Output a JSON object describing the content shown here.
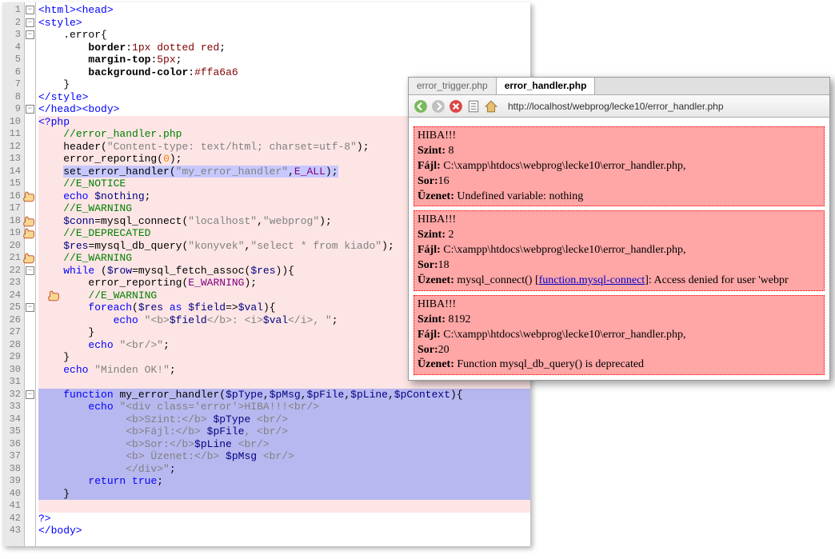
{
  "editor": {
    "lines": [
      {
        "n": 1,
        "fold": true,
        "html": "<span class='tag'>&lt;html&gt;&lt;head&gt;</span>"
      },
      {
        "n": 2,
        "fold": true,
        "html": "<span class='tag'>&lt;style&gt;</span>"
      },
      {
        "n": 3,
        "fold": true,
        "html": "    .error{"
      },
      {
        "n": 4,
        "html": "        <span class='prop'>border</span>:<span class='cssval'>1px dotted red</span>;"
      },
      {
        "n": 5,
        "html": "        <span class='prop'>margin-top</span>:<span class='cssval'>5px</span>;"
      },
      {
        "n": 6,
        "html": "        <span class='prop'>background-color</span>:<span class='cssval'>#ffa6a6</span>"
      },
      {
        "n": 7,
        "html": "    }"
      },
      {
        "n": 8,
        "html": "<span class='tag'>&lt;/style&gt;</span>"
      },
      {
        "n": 9,
        "fold": true,
        "html": "<span class='tag'>&lt;/head&gt;&lt;body&gt;</span>"
      },
      {
        "n": 10,
        "hl": "red",
        "html": "<span class='keyword'>&lt;?php</span>"
      },
      {
        "n": 11,
        "hl": "red",
        "html": "    <span class='comment'>//error_handler.php</span>"
      },
      {
        "n": 12,
        "hl": "red",
        "html": "    <span class='func'>header</span>(<span class='string'>\"Content-type: text/html; charset=utf-8\"</span>);"
      },
      {
        "n": 13,
        "hl": "red",
        "html": "    <span class='func'>error_reporting</span>(<span class='num'>0</span>);"
      },
      {
        "n": 14,
        "hl": "red",
        "html": "    <span class='hl-sel'><span class='func'>set_error_handler</span>(<span class='string'>\"my_error_handler\"</span>,<span class='const'>E_ALL</span>);</span>"
      },
      {
        "n": 15,
        "hl": "red",
        "html": "    <span class='comment'>//E_NOTICE</span>"
      },
      {
        "n": 16,
        "hl": "red",
        "hand": true,
        "html": "    <span class='keyword'>echo</span> <span class='var'>$nothing</span>;"
      },
      {
        "n": 17,
        "hl": "red",
        "html": "    <span class='comment'>//E_WARNING</span>"
      },
      {
        "n": 18,
        "hl": "red",
        "hand": true,
        "html": "    <span class='var'>$conn</span>=<span class='func'>mysql_connect</span>(<span class='string'>\"localhost\"</span>,<span class='string'>\"webprog\"</span>);"
      },
      {
        "n": 19,
        "hl": "red",
        "hand": true,
        "html": "    <span class='comment'>//E_DEPRECATED</span>"
      },
      {
        "n": 20,
        "hl": "red",
        "html": "    <span class='var'>$res</span>=<span class='func'>mysql_db_query</span>(<span class='string'>\"konyvek\"</span>,<span class='string'>\"select * from kiado\"</span>);"
      },
      {
        "n": 21,
        "hl": "red",
        "hand": true,
        "html": "    <span class='comment'>//E_WARNING</span>"
      },
      {
        "n": 22,
        "hl": "red",
        "fold": true,
        "html": "    <span class='keyword'>while</span> (<span class='var'>$row</span>=<span class='func'>mysql_fetch_assoc</span>(<span class='var'>$res</span>)){"
      },
      {
        "n": 23,
        "hl": "red",
        "html": "        <span class='func'>error_reporting</span>(<span class='const'>E_WARNING</span>);"
      },
      {
        "n": 24,
        "hl": "red",
        "hand": true,
        "indent": 1,
        "html": "        <span class='comment'>//E_WARNING</span>"
      },
      {
        "n": 25,
        "hl": "red",
        "fold": true,
        "html": "        <span class='keyword'>foreach</span>(<span class='var'>$res</span> <span class='keyword'>as</span> <span class='var'>$field</span>=&gt;<span class='var'>$val</span>){"
      },
      {
        "n": 26,
        "hl": "red",
        "html": "            <span class='keyword'>echo</span> <span class='string'>\"&lt;b&gt;</span><span class='var'>$field</span><span class='string'>&lt;/b&gt;: &lt;i&gt;</span><span class='var'>$val</span><span class='string'>&lt;/i&gt;, \"</span>;"
      },
      {
        "n": 27,
        "hl": "red",
        "html": "        }"
      },
      {
        "n": 28,
        "hl": "red",
        "html": "        <span class='keyword'>echo</span> <span class='string'>\"&lt;br/&gt;\"</span>;"
      },
      {
        "n": 29,
        "hl": "red",
        "html": "    }"
      },
      {
        "n": 30,
        "hl": "red",
        "html": "    <span class='keyword'>echo</span> <span class='string'>\"Minden OK!\"</span>;"
      },
      {
        "n": 31,
        "hl": "red",
        "html": ""
      },
      {
        "n": 32,
        "hl": "blue",
        "fold": true,
        "html": "    <span class='keyword'>function</span> <span class='func'>my_error_handler</span>(<span class='var'>$pType</span>,<span class='var'>$pMsg</span>,<span class='var'>$pFile</span>,<span class='var'>$pLine</span>,<span class='var'>$pContext</span>){"
      },
      {
        "n": 33,
        "hl": "blue",
        "html": "        <span class='keyword'>echo</span> <span class='string'>\"&lt;div class='error'&gt;HIBA!!!&lt;br/&gt;</span>"
      },
      {
        "n": 34,
        "hl": "blue",
        "html": "              <span class='string'>&lt;b&gt;Szint:&lt;/b&gt; </span><span class='var'>$pType</span><span class='string'> &lt;br/&gt;</span>"
      },
      {
        "n": 35,
        "hl": "blue",
        "html": "              <span class='string'>&lt;b&gt;Fájl:&lt;/b&gt; </span><span class='var'>$pFile</span><span class='string'>, &lt;br/&gt;</span>"
      },
      {
        "n": 36,
        "hl": "blue",
        "html": "              <span class='string'>&lt;b&gt;Sor:&lt;/b&gt;</span><span class='var'>$pLine</span><span class='string'> &lt;br/&gt;</span>"
      },
      {
        "n": 37,
        "hl": "blue",
        "html": "              <span class='string'>&lt;b&gt; Üzenet:&lt;/b&gt; </span><span class='var'>$pMsg</span><span class='string'> &lt;br/&gt;</span>"
      },
      {
        "n": 38,
        "hl": "blue",
        "html": "              <span class='string'>&lt;/div&gt;\"</span>;"
      },
      {
        "n": 39,
        "hl": "blue",
        "html": "        <span class='keyword'>return</span> <span class='keyword'>true</span>;"
      },
      {
        "n": 40,
        "hl": "blue",
        "html": "    }"
      },
      {
        "n": 41,
        "hl": "red",
        "html": ""
      },
      {
        "n": 42,
        "html": "<span class='keyword'>?&gt;</span>"
      },
      {
        "n": 43,
        "html": "<span class='tag'>&lt;/body&gt;</span>"
      }
    ]
  },
  "browser": {
    "tabs": [
      {
        "label": "error_trigger.php",
        "active": false
      },
      {
        "label": "error_handler.php",
        "active": true
      }
    ],
    "url": "http://localhost/webprog/lecke10/error_handler.php",
    "errors": [
      {
        "title": "HIBA!!!",
        "szint": "8",
        "fajl": "C:\\xampp\\htdocs\\webprog\\lecke10\\error_handler.php,",
        "sor": "16",
        "uzenet": "Undefined variable: nothing"
      },
      {
        "title": "HIBA!!!",
        "szint": "2",
        "fajl": "C:\\xampp\\htdocs\\webprog\\lecke10\\error_handler.php,",
        "sor": "18",
        "uzenet_pre": "mysql_connect() [",
        "link": "function.mysql-connect",
        "uzenet_post": "]: Access denied for user 'webpr"
      },
      {
        "title": "HIBA!!!",
        "szint": "8192",
        "fajl": "C:\\xampp\\htdocs\\webprog\\lecke10\\error_handler.php,",
        "sor": "20",
        "uzenet": "Function mysql_db_query() is deprecated"
      }
    ],
    "labels": {
      "szint": "Szint:",
      "fajl": "Fájl:",
      "sor": "Sor:",
      "uzenet": "Üzenet:"
    }
  }
}
